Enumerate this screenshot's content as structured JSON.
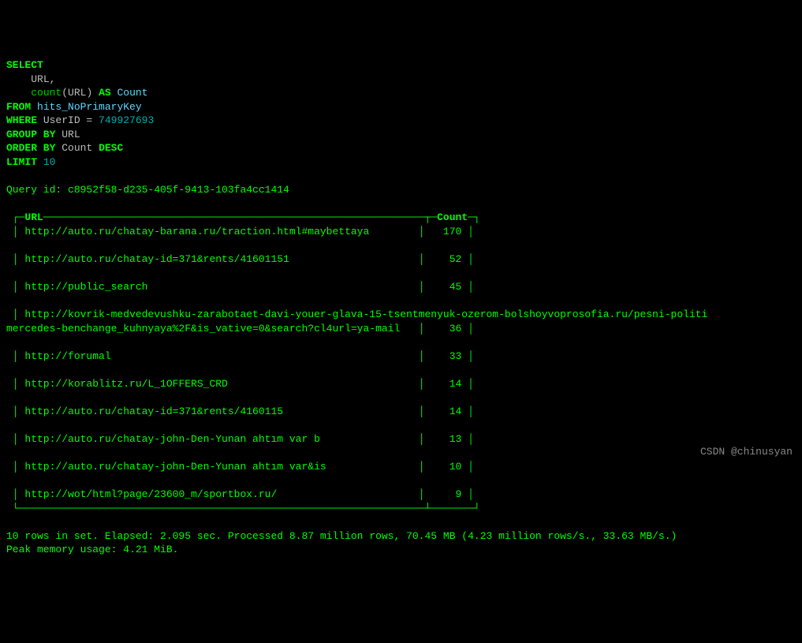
{
  "query": {
    "select_kw": "SELECT",
    "col1": "URL,",
    "func": "count",
    "func_arg": "URL",
    "as_kw": "AS",
    "alias": "Count",
    "from_kw": "FROM",
    "table": "hits_NoPrimaryKey",
    "where_kw": "WHERE",
    "where_cond_col": "UserID = ",
    "where_cond_val": "749927693",
    "group_kw": "GROUP BY",
    "group_col": "URL",
    "order_kw": "ORDER BY",
    "order_col": "Count",
    "order_dir": "DESC",
    "limit_kw": "LIMIT",
    "limit_val": "10"
  },
  "query_id_label": "Query id: ",
  "query_id": "c8952f58-d235-405f-9413-103fa4cc1414",
  "table_header": {
    "url": "URL",
    "count": "Count"
  },
  "rows": [
    {
      "url": "http://auto.ru/chatay-barana.ru/traction.html#maybettaya",
      "count": "170"
    },
    {
      "url": "http://auto.ru/chatay-id=371&rents/41601151",
      "count": "52"
    },
    {
      "url": "http://public_search",
      "count": "45"
    },
    {
      "url": "http://kovrik-medvedevushku-zarabotaet-davi-youer-glava-15-tsentmenyuk-ozerom-bolshoyvoprosofia.ru/pesni-politi",
      "url2": "mercedes-benchange_kuhnyaya%2F&is_vative=0&search?cl4url=ya-mail",
      "count": "36"
    },
    {
      "url": "http://forumal",
      "count": "33"
    },
    {
      "url": "http://korablitz.ru/L_1OFFERS_CRD",
      "count": "14"
    },
    {
      "url": "http://auto.ru/chatay-id=371&rents/4160115",
      "count": "14"
    },
    {
      "url": "http://auto.ru/chatay-john-Den-Yunan ahtım var b",
      "count": "13"
    },
    {
      "url": "http://auto.ru/chatay-john-Den-Yunan ahtım var&is",
      "count": "10"
    },
    {
      "url": "http://wot/html?page/23600_m/sportbox.ru/",
      "count": "9"
    }
  ],
  "footer": {
    "line1": "10 rows in set. Elapsed: 2.095 sec. Processed 8.87 million rows, 70.45 MB (4.23 million rows/s., 33.63 MB/s.)",
    "line2": "Peak memory usage: 4.21 MiB."
  },
  "watermark": "CSDN @chinusyan"
}
